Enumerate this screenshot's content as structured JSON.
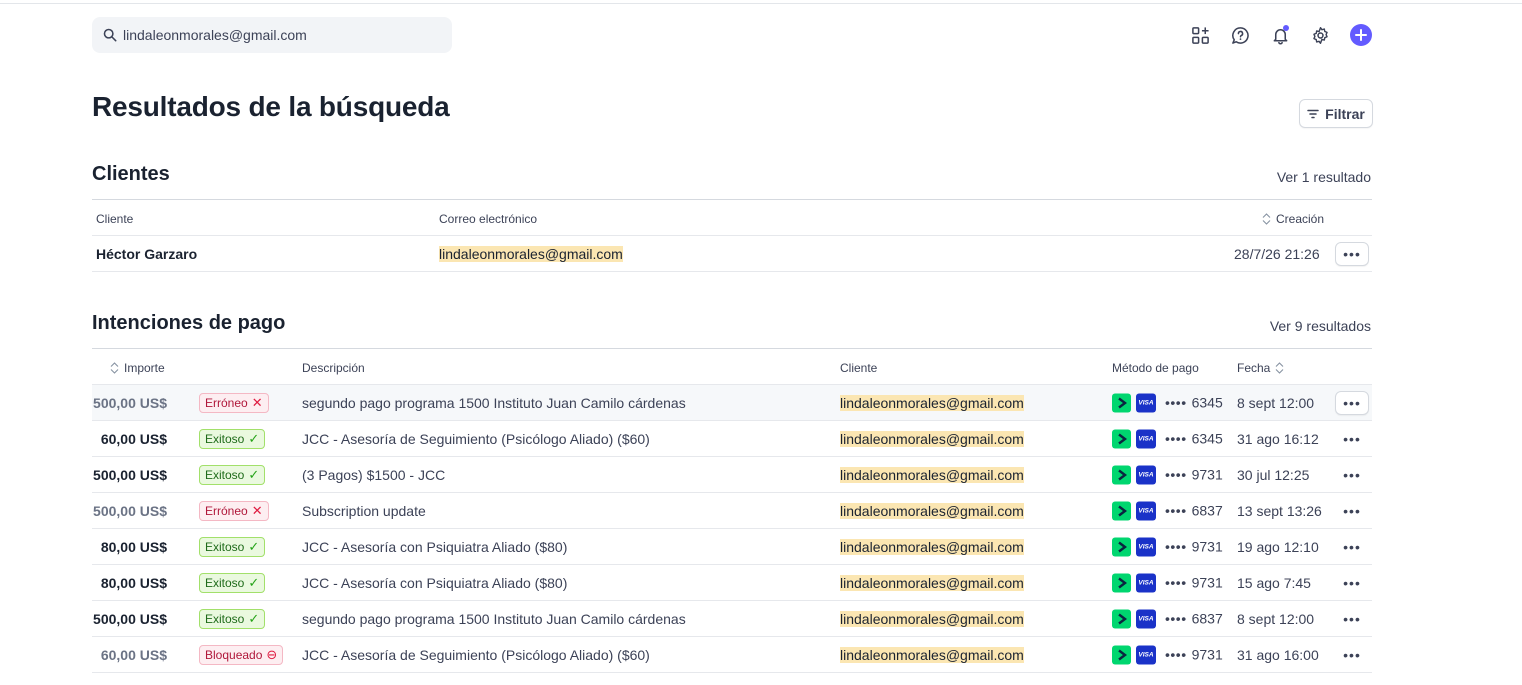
{
  "search": {
    "value": "lindaleonmorales@gmail.com"
  },
  "top_icons": [
    "apps-add-icon",
    "help-icon",
    "bell-icon",
    "settings-icon",
    "add-icon"
  ],
  "page_title": "Resultados de la búsqueda",
  "filter_label": "Filtrar",
  "customers": {
    "title": "Clientes",
    "see_all": "Ver 1 resultado",
    "columns": {
      "customer": "Cliente",
      "email": "Correo electrónico",
      "created": "Creación"
    },
    "rows": [
      {
        "name": "Héctor Garzaro",
        "email": "lindaleonmorales@gmail.com",
        "created": "28/7/26 21:26"
      }
    ]
  },
  "payments": {
    "title": "Intenciones de pago",
    "see_all": "Ver 9 resultados",
    "columns": {
      "amount": "Importe",
      "description": "Descripción",
      "customer": "Cliente",
      "method": "Método de pago",
      "date": "Fecha"
    },
    "card_brand": "VISA",
    "card_mask": "••••",
    "rows": [
      {
        "amount": "500,00 US$",
        "status": "Erróneo",
        "status_type": "err",
        "description": "segundo pago programa 1500 Instituto Juan Camilo cárdenas",
        "customer": "lindaleonmorales@gmail.com",
        "last4": "6345",
        "date": "8 sept 12:00"
      },
      {
        "amount": "60,00 US$",
        "status": "Exitoso",
        "status_type": "ok",
        "description": "JCC - Asesoría de Seguimiento (Psicólogo Aliado) ($60)",
        "customer": "lindaleonmorales@gmail.com",
        "last4": "6345",
        "date": "31 ago 16:12"
      },
      {
        "amount": "500,00 US$",
        "status": "Exitoso",
        "status_type": "ok",
        "description": "(3 Pagos) $1500 - JCC",
        "customer": "lindaleonmorales@gmail.com",
        "last4": "9731",
        "date": "30 jul 12:25"
      },
      {
        "amount": "500,00 US$",
        "status": "Erróneo",
        "status_type": "err",
        "description": "Subscription update",
        "customer": "lindaleonmorales@gmail.com",
        "last4": "6837",
        "date": "13 sept 13:26"
      },
      {
        "amount": "80,00 US$",
        "status": "Exitoso",
        "status_type": "ok",
        "description": "JCC - Asesoría con Psiquiatra Aliado ($80)",
        "customer": "lindaleonmorales@gmail.com",
        "last4": "9731",
        "date": "19 ago 12:10"
      },
      {
        "amount": "80,00 US$",
        "status": "Exitoso",
        "status_type": "ok",
        "description": "JCC - Asesoría con Psiquiatra Aliado ($80)",
        "customer": "lindaleonmorales@gmail.com",
        "last4": "9731",
        "date": "15 ago 7:45"
      },
      {
        "amount": "500,00 US$",
        "status": "Exitoso",
        "status_type": "ok",
        "description": "segundo pago programa 1500 Instituto Juan Camilo cárdenas",
        "customer": "lindaleonmorales@gmail.com",
        "last4": "6837",
        "date": "8 sept 12:00"
      },
      {
        "amount": "60,00 US$",
        "status": "Bloqueado",
        "status_type": "blocked",
        "description": "JCC - Asesoría de Seguimiento (Psicólogo Aliado) ($60)",
        "customer": "lindaleonmorales@gmail.com",
        "last4": "9731",
        "date": "31 ago 16:00"
      }
    ]
  },
  "colors": {
    "accent": "#635bff",
    "highlight": "#fbe6b2",
    "success": "#25a318",
    "error": "#df1b41",
    "link_green": "#00d66f",
    "visa_blue": "#1a32c8"
  }
}
